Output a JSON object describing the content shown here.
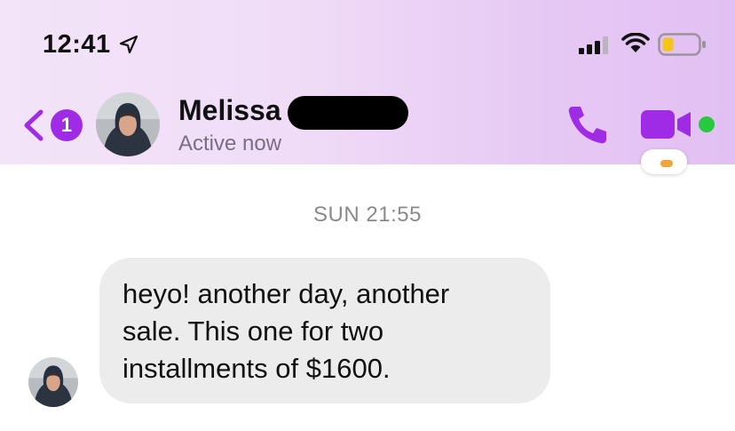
{
  "status_bar": {
    "time": "12:41",
    "icons": [
      "location-arrow-icon",
      "cellular-signal-icon",
      "wifi-icon",
      "battery-icon"
    ]
  },
  "header": {
    "unread_count": "1",
    "contact_name": "Melissa",
    "contact_status": "Active now",
    "actions": [
      "phone-icon",
      "video-camera-icon"
    ]
  },
  "conversation": {
    "timestamp": "SUN 21:55",
    "messages": [
      {
        "direction": "incoming",
        "lines": [
          "heyo! another day, another",
          "sale. This one for two",
          "installments of $1600."
        ]
      }
    ]
  },
  "colors": {
    "accent": "#a02be6",
    "online": "#28c840",
    "bubble_incoming": "#ececec",
    "battery_low": "#f5c518"
  }
}
